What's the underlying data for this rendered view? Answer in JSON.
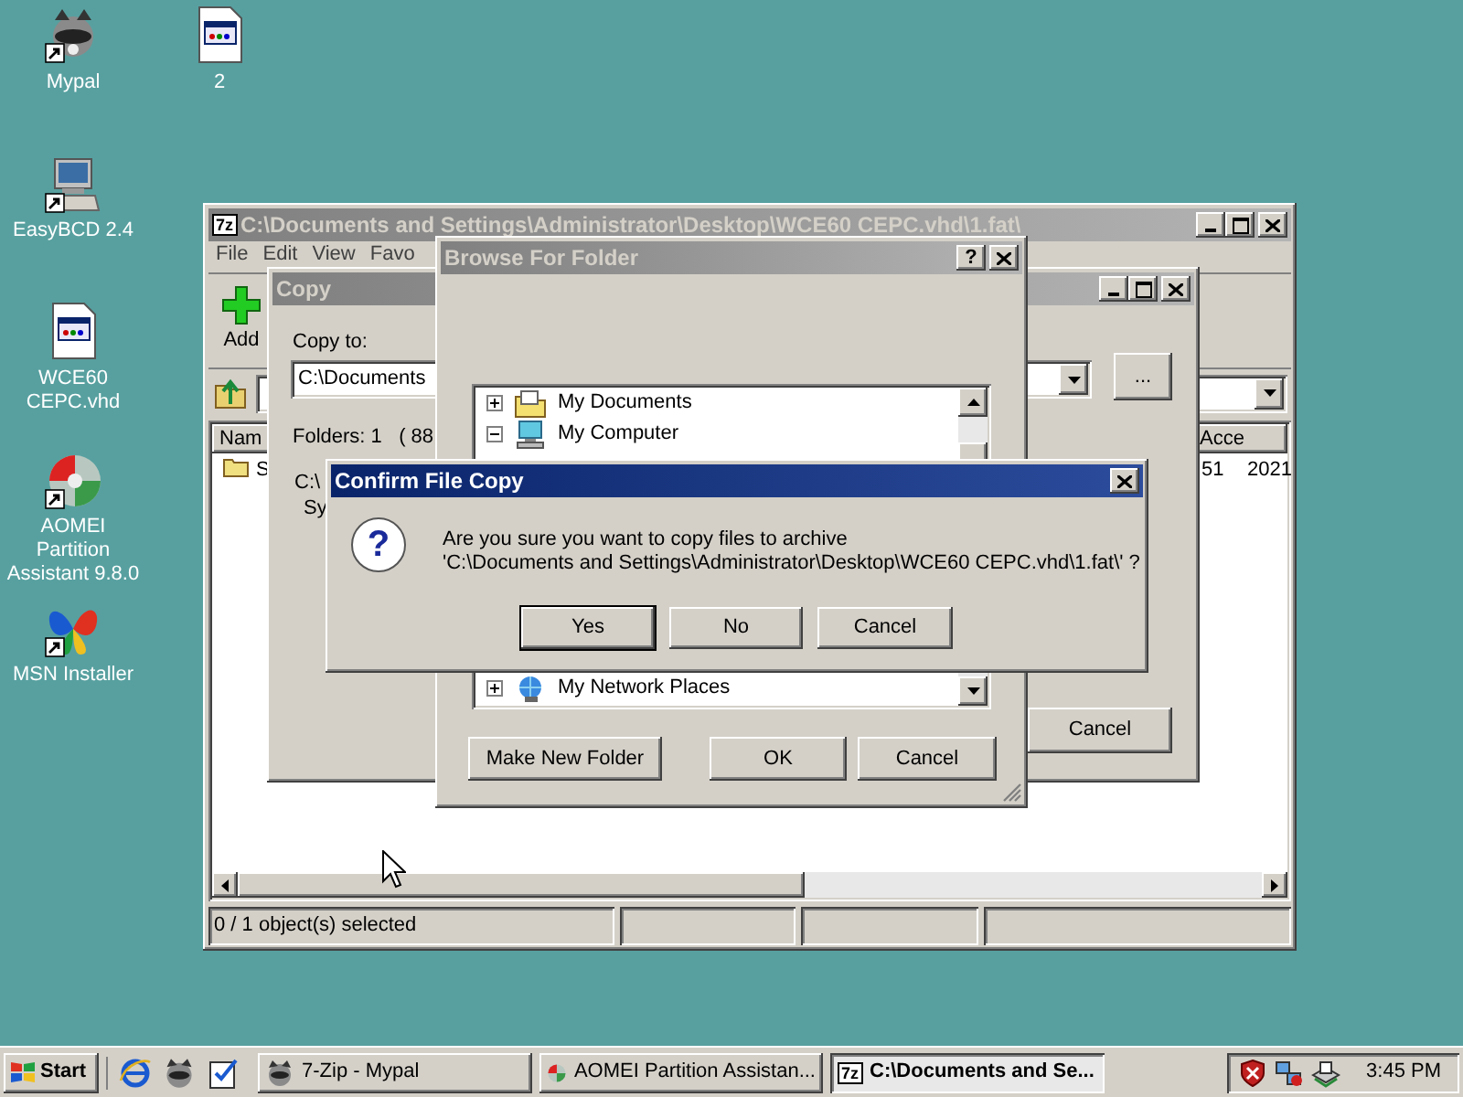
{
  "desktop_icons": [
    {
      "label": "Mypal",
      "shortcut": true
    },
    {
      "label": "2",
      "shortcut": false
    },
    {
      "label": "EasyBCD 2.4",
      "shortcut": true
    },
    {
      "label": "WCE60 CEPC.vhd",
      "shortcut": false
    },
    {
      "label": "AOMEI Partition Assistant 9.8.0",
      "shortcut": true
    },
    {
      "label": "MSN Installer",
      "shortcut": true
    }
  ],
  "main_window": {
    "title": "C:\\Documents and Settings\\Administrator\\Desktop\\WCE60 CEPC.vhd\\1.fat\\",
    "title_icon": "7z",
    "active": false,
    "menu": [
      "File",
      "Edit",
      "View",
      "Favo"
    ],
    "toolbar": [
      "Add"
    ],
    "columns": [
      "Nam",
      "Acce"
    ],
    "rows": [
      {
        "name": "S",
        "column_2": "51",
        "column_3": "2021"
      }
    ],
    "status_bar": [
      "0 / 1 object(s) selected"
    ]
  },
  "copy_dialog": {
    "title": "Copy",
    "active": false,
    "copy_to_label": "Copy to:",
    "path_value": "C:\\Documents",
    "browse_button": "...",
    "info": [
      "Folders: 1   ( 88",
      "C:\\",
      "Sy"
    ],
    "cancel_button": "Cancel"
  },
  "browse_dialog": {
    "title": "Browse For Folder",
    "active": false,
    "help_glyph": "?",
    "tree": [
      {
        "label": "My Documents",
        "expanded": false
      },
      {
        "label": "My Computer",
        "expanded": true
      },
      {
        "label": "My Network Places",
        "expanded": false
      }
    ],
    "buttons": [
      "Make New Folder",
      "OK",
      "Cancel"
    ]
  },
  "confirm_dialog": {
    "title": "Confirm File Copy",
    "active": true,
    "icon_glyph": "?",
    "message": "Are you sure you want to copy files to archive\n'C:\\Documents and Settings\\Administrator\\Desktop\\WCE60 CEPC.vhd\\1.fat\\' ?",
    "buttons": [
      {
        "label": "Yes",
        "default": true
      },
      {
        "label": "No",
        "default": false
      },
      {
        "label": "Cancel",
        "default": false
      }
    ]
  },
  "taskbar": {
    "start": "Start",
    "tasks": [
      {
        "label": "7-Zip - Mypal",
        "kind": "animal",
        "selected": false
      },
      {
        "label": "AOMEI Partition Assistan...",
        "kind": "disk",
        "selected": false
      },
      {
        "label": "C:\\Documents and Se...",
        "kind": "archive",
        "icon_text": "7z",
        "selected": true
      }
    ],
    "clock": "3:45 PM"
  }
}
